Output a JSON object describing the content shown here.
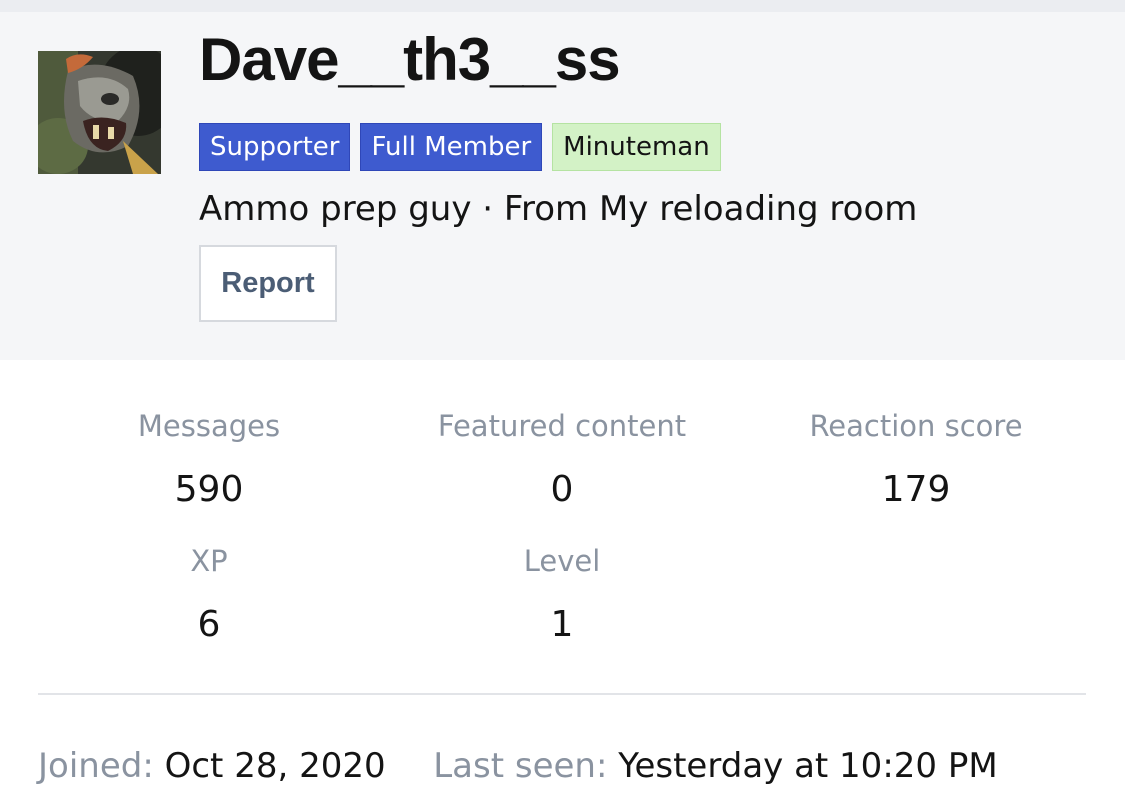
{
  "profile": {
    "username": "Dave__th3__ss",
    "avatar_icon": "profile-photo",
    "badges": [
      {
        "label": "Supporter",
        "color": "#3e5bcf"
      },
      {
        "label": "Full Member",
        "color": "#3e5bcf"
      },
      {
        "label": "Minuteman",
        "color": "#d3f2c6"
      }
    ],
    "tagline": "Ammo prep guy · From My reloading room",
    "report_label": "Report"
  },
  "stats": [
    {
      "label": "Messages",
      "value": "590"
    },
    {
      "label": "Featured content",
      "value": "0"
    },
    {
      "label": "Reaction score",
      "value": "179"
    },
    {
      "label": "XP",
      "value": "6"
    },
    {
      "label": "Level",
      "value": "1"
    }
  ],
  "info": {
    "joined_label": "Joined:",
    "joined_value": "Oct 28, 2020",
    "last_seen_label": "Last seen:",
    "last_seen_value": "Yesterday at 10:20 PM"
  }
}
